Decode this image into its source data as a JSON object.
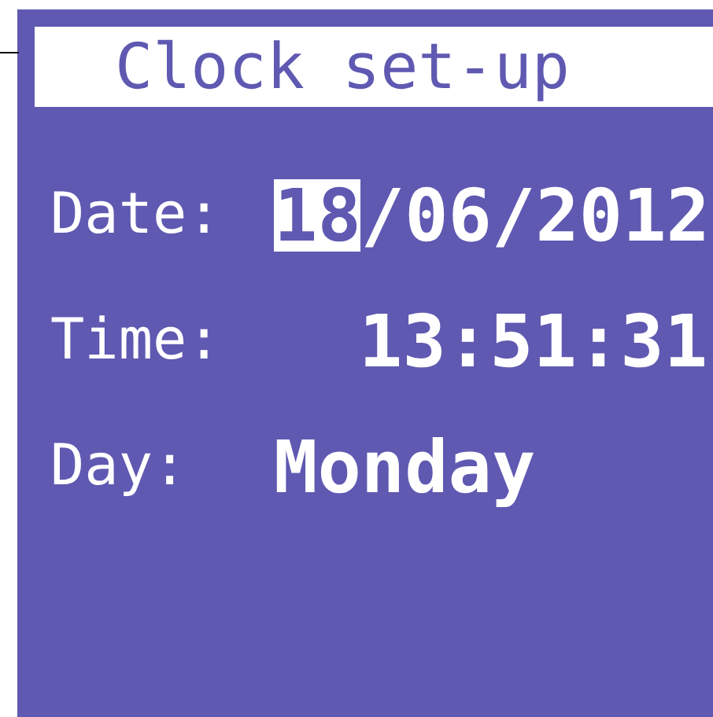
{
  "title": "Clock set-up",
  "fields": [
    {
      "label": "Date:",
      "parts": [
        {
          "text": "18",
          "selected": true
        },
        {
          "text": "/",
          "selected": false
        },
        {
          "text": "06",
          "selected": false
        },
        {
          "text": "/",
          "selected": false
        },
        {
          "text": "2012",
          "selected": false
        }
      ]
    },
    {
      "label": "Time:",
      "parts": [
        {
          "text": "13:51:31",
          "selected": false
        }
      ]
    },
    {
      "label": "Day:",
      "parts": [
        {
          "text": "Monday",
          "selected": false
        }
      ]
    }
  ]
}
